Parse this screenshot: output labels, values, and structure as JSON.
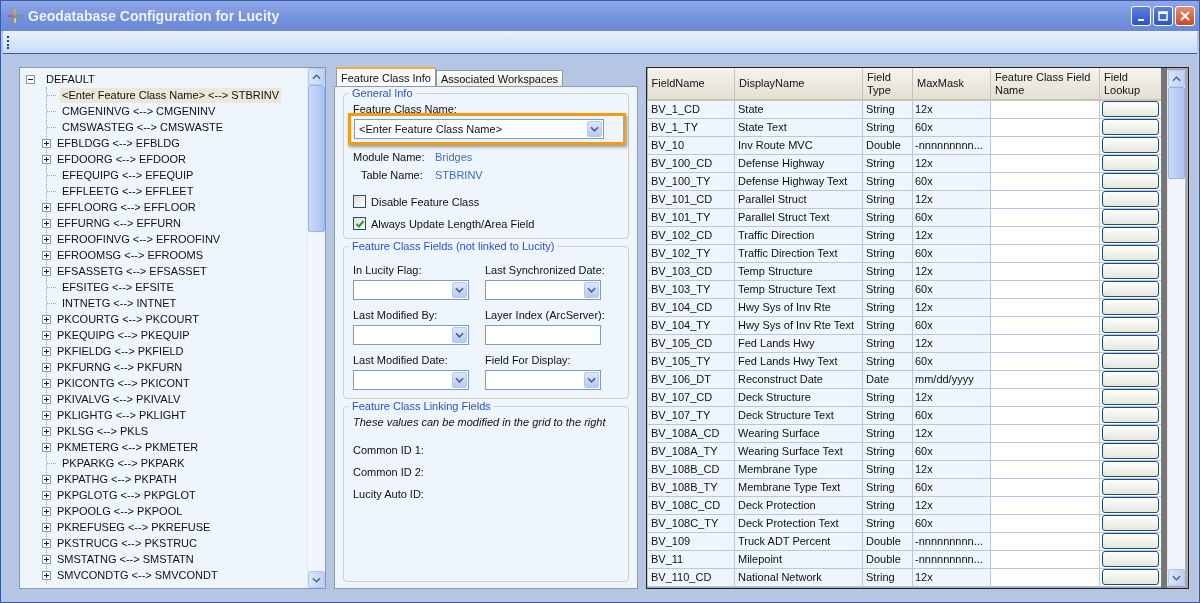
{
  "window": {
    "title": "Geodatabase Configuration for Lucity"
  },
  "tree": {
    "root": {
      "label": "DEFAULT",
      "expanded": true,
      "children": [
        {
          "label": "<Enter Feature Class Name> <--> STBRINV",
          "has_children": false,
          "selected": true
        },
        {
          "label": "CMGENINVG <--> CMGENINV",
          "has_children": false,
          "selected": false
        },
        {
          "label": "CMSWASTEG <--> CMSWASTE",
          "has_children": false,
          "selected": false
        },
        {
          "label": "EFBLDGG <--> EFBLDG",
          "has_children": true,
          "selected": false
        },
        {
          "label": "EFDOORG <--> EFDOOR",
          "has_children": true,
          "selected": false
        },
        {
          "label": "EFEQUIPG <--> EFEQUIP",
          "has_children": false,
          "selected": false
        },
        {
          "label": "EFFLEETG <--> EFFLEET",
          "has_children": false,
          "selected": false
        },
        {
          "label": "EFFLOORG <--> EFFLOOR",
          "has_children": true,
          "selected": false
        },
        {
          "label": "EFFURNG <--> EFFURN",
          "has_children": true,
          "selected": false
        },
        {
          "label": "EFROOFINVG <--> EFROOFINV",
          "has_children": true,
          "selected": false
        },
        {
          "label": "EFROOMSG <--> EFROOMS",
          "has_children": true,
          "selected": false
        },
        {
          "label": "EFSASSETG <--> EFSASSET",
          "has_children": true,
          "selected": false
        },
        {
          "label": "EFSITEG <--> EFSITE",
          "has_children": false,
          "selected": false
        },
        {
          "label": "INTNETG <--> INTNET",
          "has_children": false,
          "selected": false
        },
        {
          "label": "PKCOURTG <--> PKCOURT",
          "has_children": true,
          "selected": false
        },
        {
          "label": "PKEQUIPG <--> PKEQUIP",
          "has_children": true,
          "selected": false
        },
        {
          "label": "PKFIELDG <--> PKFIELD",
          "has_children": true,
          "selected": false
        },
        {
          "label": "PKFURNG <--> PKFURN",
          "has_children": true,
          "selected": false
        },
        {
          "label": "PKICONTG <--> PKICONT",
          "has_children": true,
          "selected": false
        },
        {
          "label": "PKIVALVG <--> PKIVALV",
          "has_children": true,
          "selected": false
        },
        {
          "label": "PKLIGHTG <--> PKLIGHT",
          "has_children": true,
          "selected": false
        },
        {
          "label": "PKLSG <--> PKLS",
          "has_children": true,
          "selected": false
        },
        {
          "label": "PKMETERG <--> PKMETER",
          "has_children": true,
          "selected": false
        },
        {
          "label": "PKPARKG <--> PKPARK",
          "has_children": false,
          "selected": false
        },
        {
          "label": "PKPATHG <--> PKPATH",
          "has_children": true,
          "selected": false
        },
        {
          "label": "PKPGLOTG <--> PKPGLOT",
          "has_children": true,
          "selected": false
        },
        {
          "label": "PKPOOLG <--> PKPOOL",
          "has_children": true,
          "selected": false
        },
        {
          "label": "PKREFUSEG <--> PKREFUSE",
          "has_children": true,
          "selected": false
        },
        {
          "label": "PKSTRUCG <--> PKSTRUC",
          "has_children": true,
          "selected": false
        },
        {
          "label": "SMSTATNG <--> SMSTATN",
          "has_children": true,
          "selected": false
        },
        {
          "label": "SMVCONDTG <--> SMVCONDT",
          "has_children": true,
          "selected": false
        }
      ]
    }
  },
  "tabs": [
    {
      "label": "Feature Class Info",
      "selected": true
    },
    {
      "label": "Associated Workspaces",
      "selected": false
    }
  ],
  "general_info": {
    "title": "General Info",
    "feature_class_label": "Feature Class Name:",
    "feature_class_value": "<Enter Feature Class Name>",
    "highlighted": true,
    "module_label": "Module Name:",
    "module_value": "Bridges",
    "table_label": "Table Name:",
    "table_value": "STBRINV",
    "checkboxes": [
      {
        "label": "Disable Feature Class",
        "checked": false
      },
      {
        "label": "Always Update Length/Area Field",
        "checked": true
      }
    ]
  },
  "feature_class_fields": {
    "title": "Feature Class Fields (not linked to Lucity)",
    "fields": [
      {
        "label": "In Lucity Flag:",
        "kind": "combo"
      },
      {
        "label": "Last Synchronized Date:",
        "kind": "combo"
      },
      {
        "label": "Last Modified By:",
        "kind": "combo"
      },
      {
        "label": "Layer Index (ArcServer):",
        "kind": "text"
      },
      {
        "label": "Last Modified Date:",
        "kind": "combo"
      },
      {
        "label": "Field For Display:",
        "kind": "combo"
      }
    ]
  },
  "linking_fields": {
    "title": "Feature Class Linking Fields",
    "note": "These values can be modified in the grid to the right",
    "labels": [
      "Common ID 1:",
      "Common ID 2:",
      "Lucity Auto ID:"
    ]
  },
  "grid": {
    "columns": [
      "FieldName",
      "DisplayName",
      "Field Type",
      "MaxMask",
      "Feature Class Field Name",
      "Field Lookup"
    ],
    "rows": [
      [
        "BV_1_CD",
        "State",
        "String",
        "12x"
      ],
      [
        "BV_1_TY",
        "State Text",
        "String",
        "60x"
      ],
      [
        "BV_10",
        "Inv Route MVC",
        "Double",
        "-nnnnnnnnn..."
      ],
      [
        "BV_100_CD",
        "Defense Highway",
        "String",
        "12x"
      ],
      [
        "BV_100_TY",
        "Defense Highway Text",
        "String",
        "60x"
      ],
      [
        "BV_101_CD",
        "Parallel Struct",
        "String",
        "12x"
      ],
      [
        "BV_101_TY",
        "Parallel Struct Text",
        "String",
        "60x"
      ],
      [
        "BV_102_CD",
        "Traffic Direction",
        "String",
        "12x"
      ],
      [
        "BV_102_TY",
        "Traffic Direction Text",
        "String",
        "60x"
      ],
      [
        "BV_103_CD",
        "Temp Structure",
        "String",
        "12x"
      ],
      [
        "BV_103_TY",
        "Temp Structure Text",
        "String",
        "60x"
      ],
      [
        "BV_104_CD",
        "Hwy Sys of Inv Rte",
        "String",
        "12x"
      ],
      [
        "BV_104_TY",
        "Hwy Sys of Inv Rte Text",
        "String",
        "60x"
      ],
      [
        "BV_105_CD",
        "Fed Lands Hwy",
        "String",
        "12x"
      ],
      [
        "BV_105_TY",
        "Fed Lands Hwy Text",
        "String",
        "60x"
      ],
      [
        "BV_106_DT",
        "Reconstruct Date",
        "Date",
        "mm/dd/yyyy"
      ],
      [
        "BV_107_CD",
        "Deck Structure",
        "String",
        "12x"
      ],
      [
        "BV_107_TY",
        "Deck Structure Text",
        "String",
        "60x"
      ],
      [
        "BV_108A_CD",
        "Wearing Surface",
        "String",
        "12x"
      ],
      [
        "BV_108A_TY",
        "Wearing Surface Text",
        "String",
        "60x"
      ],
      [
        "BV_108B_CD",
        "Membrane Type",
        "String",
        "12x"
      ],
      [
        "BV_108B_TY",
        "Membrane Type Text",
        "String",
        "60x"
      ],
      [
        "BV_108C_CD",
        "Deck Protection",
        "String",
        "12x"
      ],
      [
        "BV_108C_TY",
        "Deck Protection Text",
        "String",
        "60x"
      ],
      [
        "BV_109",
        "Truck ADT Percent",
        "Double",
        "-nnnnnnnnn..."
      ],
      [
        "BV_11",
        "Milepoint",
        "Double",
        "-nnnnnnnnn..."
      ],
      [
        "BV_110_CD",
        "National Network",
        "String",
        "12x"
      ]
    ]
  }
}
